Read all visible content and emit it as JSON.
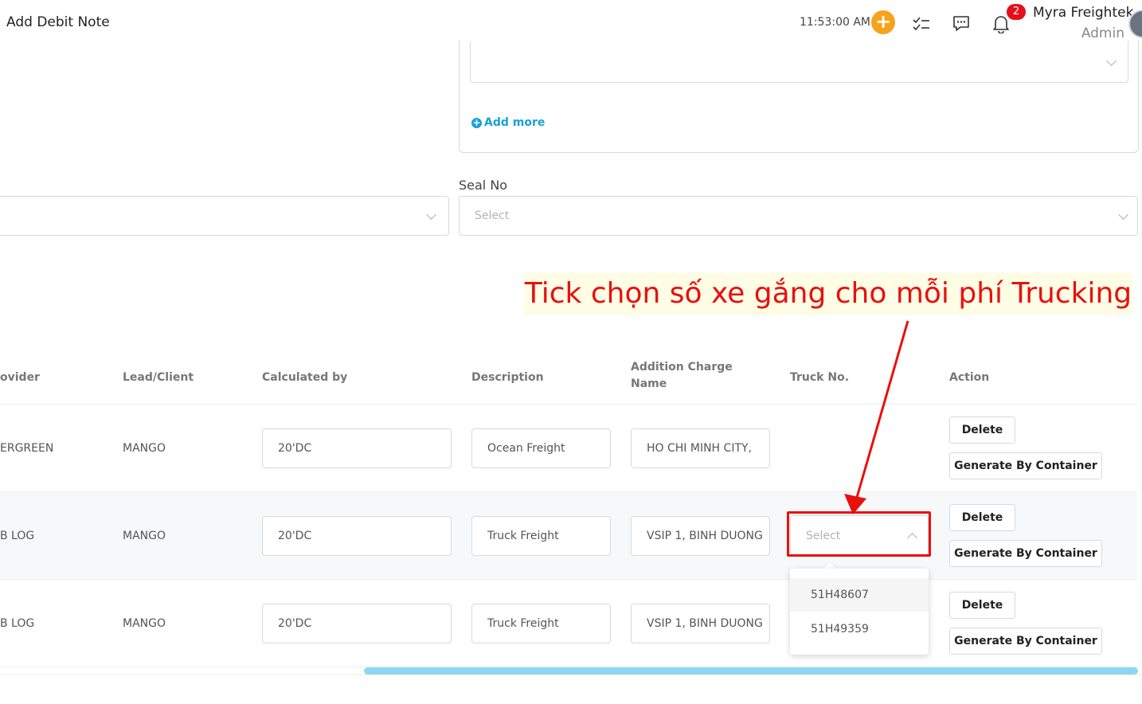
{
  "header": {
    "title": "Add Debit Note",
    "time": "11:53:00 AM",
    "notification_count": "2",
    "user_name": "Myra Freightek",
    "user_role": "Admin",
    "accent_color": "#f7a21b",
    "icons": [
      "plus-icon",
      "task-list-icon",
      "chat-icon",
      "bell-icon"
    ]
  },
  "top_panel": {
    "add_more_label": "Add more"
  },
  "seal": {
    "label": "Seal No",
    "placeholder": "Select"
  },
  "annotation": {
    "text": "Tick chọn số xe gắng cho mỗi phí Trucking",
    "color": "#e8100d"
  },
  "table": {
    "headers": {
      "provider": "ovider",
      "lead_client": "Lead/Client",
      "calculated_by": "Calculated by",
      "description": "Description",
      "addition_charge_1": "Addition Charge",
      "addition_charge_2": "Name",
      "truck_no": "Truck No.",
      "action": "Action"
    },
    "rows": [
      {
        "provider": "ERGREEN",
        "lead_client": "MANGO",
        "calculated_by": "20'DC",
        "description": "Ocean Freight",
        "addition_charge": "HO CHI MINH CITY,",
        "delete_label": "Delete",
        "generate_label": "Generate By Container"
      },
      {
        "provider": "B LOG",
        "lead_client": "MANGO",
        "calculated_by": "20'DC",
        "description": "Truck Freight",
        "addition_charge": "VSIP 1, BINH DUONG",
        "truck_placeholder": "Select",
        "delete_label": "Delete",
        "generate_label": "Generate By Container"
      },
      {
        "provider": "B LOG",
        "lead_client": "MANGO",
        "calculated_by": "20'DC",
        "description": "Truck Freight",
        "addition_charge": "VSIP 1, BINH DUONG",
        "delete_label": "Delete",
        "generate_label": "Generate By Container"
      }
    ],
    "truck_options": [
      "51H48607",
      "51H49359"
    ]
  }
}
